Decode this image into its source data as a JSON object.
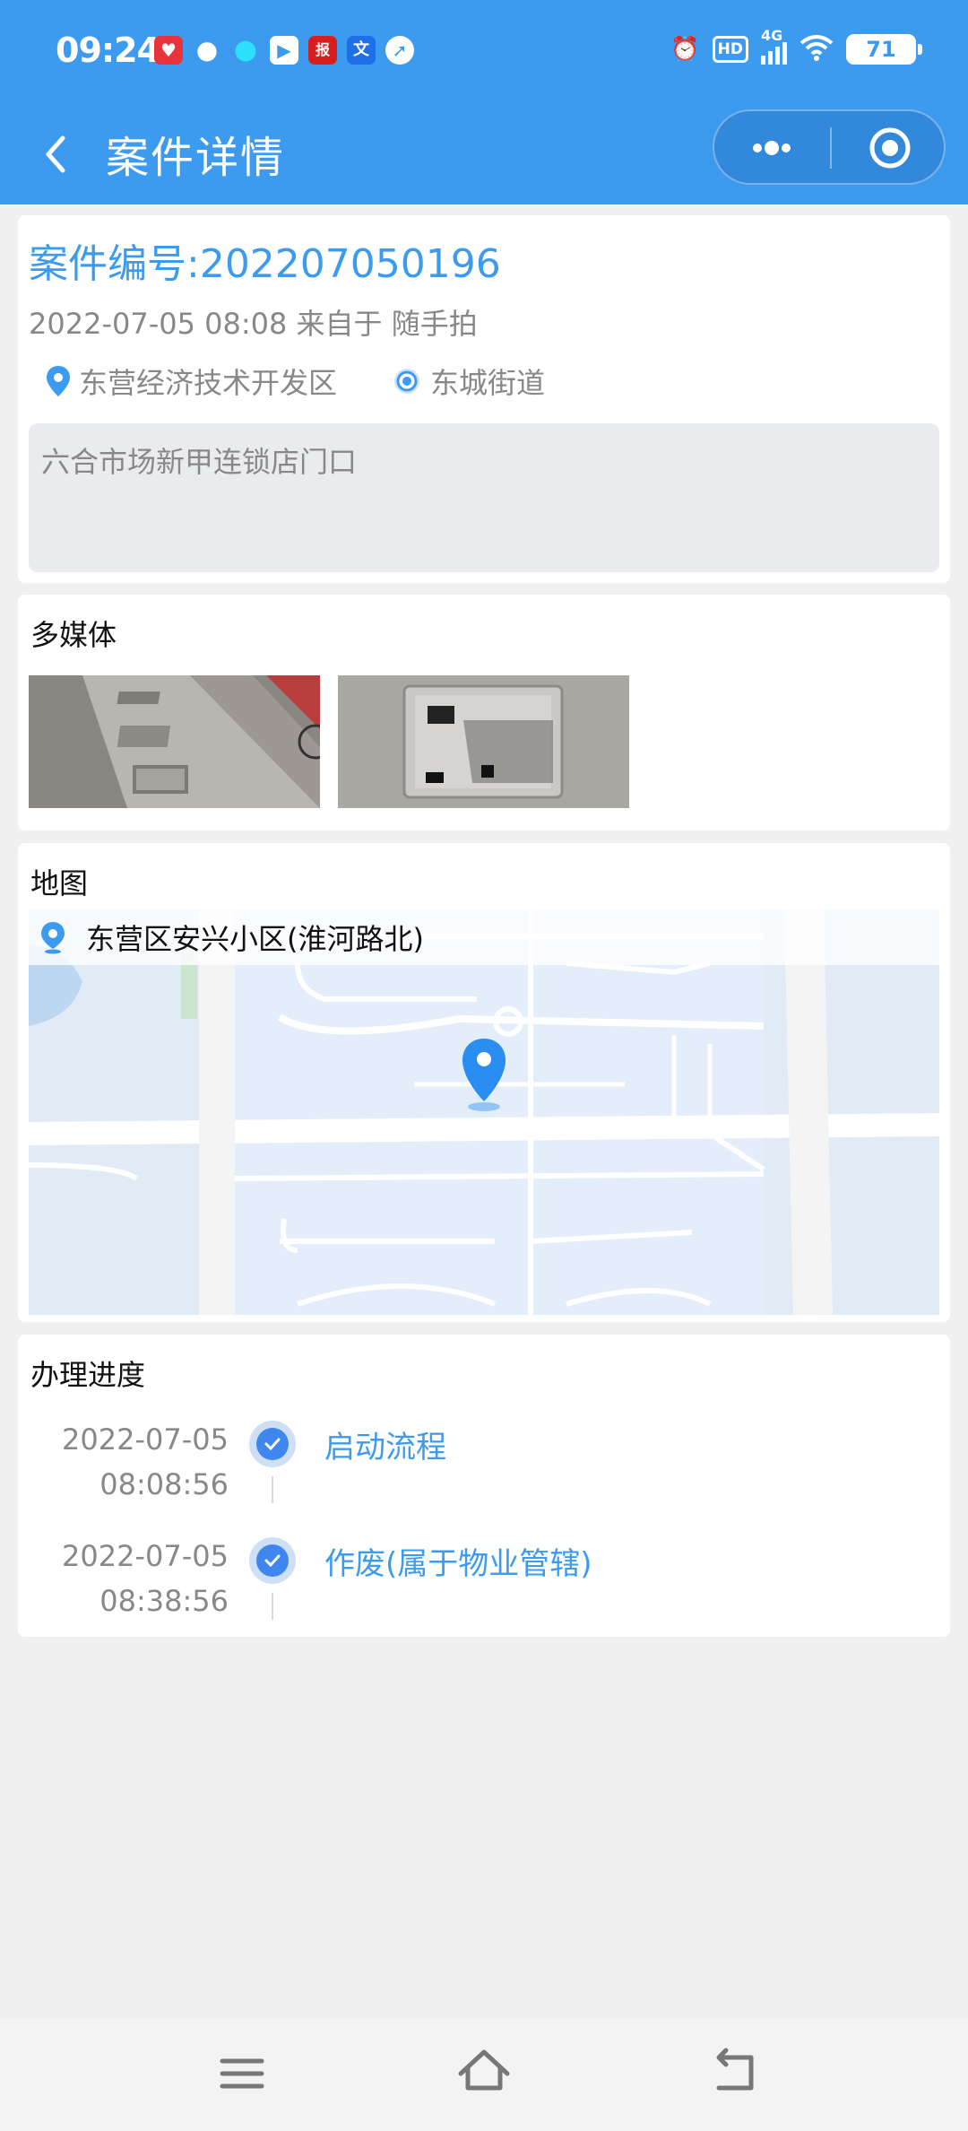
{
  "status_bar": {
    "time": "09:24",
    "app_icons": [
      "heart-app-icon",
      "wechat-icon",
      "qq-icon",
      "video-icon",
      "news-icon",
      "translate-icon",
      "compass-icon"
    ],
    "network": "4G",
    "hd_label": "HD",
    "battery": "71"
  },
  "header": {
    "title": "案件详情",
    "color": "#3d9bef"
  },
  "case": {
    "number": "案件编号:202207050196",
    "meta": "2022-07-05 08:08 来自于 随手拍",
    "district": "东营经济技术开发区",
    "street": "东城街道",
    "address": "六合市场新甲连锁店门口"
  },
  "media": {
    "title": "多媒体",
    "images": [
      "photo-1",
      "photo-2"
    ]
  },
  "map": {
    "title": "地图",
    "address": "东营区安兴小区(淮河路北)"
  },
  "progress": {
    "title": "办理进度",
    "steps": [
      {
        "date": "2022-07-05",
        "time": "08:08:56",
        "label": "启动流程"
      },
      {
        "date": "2022-07-05",
        "time": "08:38:56",
        "label": "作废(属于物业管辖)"
      }
    ]
  }
}
